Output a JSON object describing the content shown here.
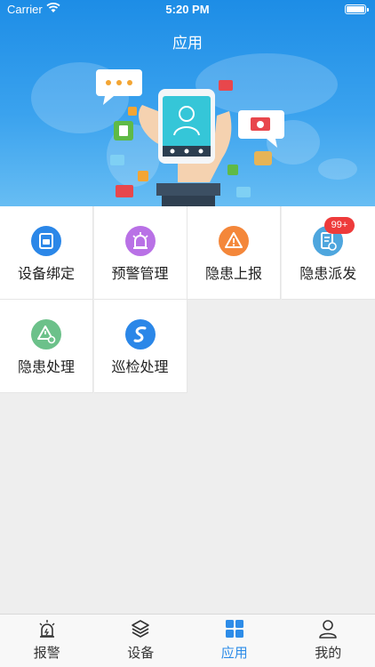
{
  "status_bar": {
    "carrier": "Carrier",
    "time": "5:20 PM"
  },
  "header": {
    "title": "应用"
  },
  "apps": [
    {
      "label": "设备绑定",
      "icon": "device-bind-icon",
      "color": "#2b87e8"
    },
    {
      "label": "预警管理",
      "icon": "alarm-light-icon",
      "color": "#b971e6"
    },
    {
      "label": "隐患上报",
      "icon": "warning-triangle-icon",
      "color": "#f4873a"
    },
    {
      "label": "隐患派发",
      "icon": "dispatch-doc-icon",
      "color": "#4ea6de",
      "badge": "99+"
    },
    {
      "label": "隐患处理",
      "icon": "hazard-settings-icon",
      "color": "#6cc18a"
    },
    {
      "label": "巡检处理",
      "icon": "patrol-route-icon",
      "color": "#2b87e8"
    }
  ],
  "tabbar": {
    "items": [
      {
        "label": "报警",
        "icon": "alarm-light-icon"
      },
      {
        "label": "设备",
        "icon": "layers-icon"
      },
      {
        "label": "应用",
        "icon": "grid-apps-icon",
        "active": true
      },
      {
        "label": "我的",
        "icon": "user-icon"
      }
    ],
    "active_color": "#2d8ce8"
  }
}
